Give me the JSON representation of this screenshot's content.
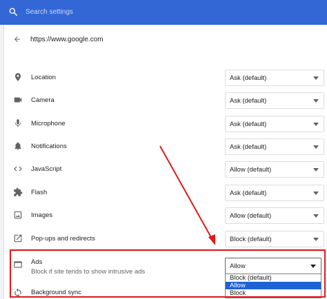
{
  "search": {
    "placeholder": "Search settings",
    "icon": "search-icon"
  },
  "site": {
    "url": "https://www.google.com",
    "back_icon": "back-arrow-icon"
  },
  "permissions": [
    {
      "label": "Location",
      "icon": "location-pin-icon",
      "value": "Ask (default)"
    },
    {
      "label": "Camera",
      "icon": "camera-icon",
      "value": "Ask (default)"
    },
    {
      "label": "Microphone",
      "icon": "microphone-icon",
      "value": "Ask (default)"
    },
    {
      "label": "Notifications",
      "icon": "bell-icon",
      "value": "Ask (default)"
    },
    {
      "label": "JavaScript",
      "icon": "code-brackets-icon",
      "value": "Allow (default)"
    },
    {
      "label": "Flash",
      "icon": "puzzle-piece-icon",
      "value": "Ask (default)"
    },
    {
      "label": "Images",
      "icon": "image-icon",
      "value": "Allow (default)"
    },
    {
      "label": "Pop-ups and redirects",
      "icon": "external-link-icon",
      "value": "Block (default)"
    }
  ],
  "ads": {
    "label": "Ads",
    "icon": "window-icon",
    "description": "Block if site tends to show intrusive ads",
    "value": "Allow",
    "options": [
      "Block (default)",
      "Allow",
      "Block"
    ],
    "selected_option": "Allow"
  },
  "background_sync": {
    "label": "Background sync",
    "icon": "sync-icon"
  },
  "colors": {
    "header": "#3367d6",
    "highlight": "#e0181b",
    "selection": "#1e63d6"
  }
}
